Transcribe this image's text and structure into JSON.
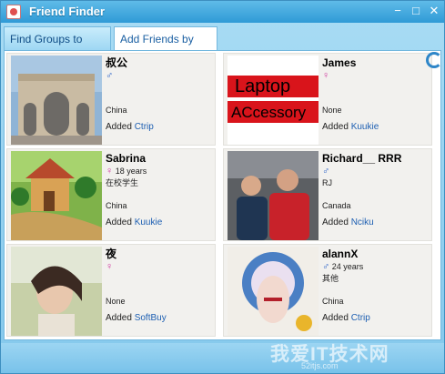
{
  "window": {
    "title": "Friend Finder"
  },
  "tabs": [
    {
      "label": "Find Groups to Join"
    },
    {
      "label": "Add Friends by App"
    }
  ],
  "added_prefix": "Added",
  "friends": [
    {
      "name": "叔公",
      "gender": "♂",
      "age": "",
      "status": "",
      "location": "China",
      "app": "Ctrip"
    },
    {
      "name": "James",
      "gender": "♀",
      "age": "",
      "status": "",
      "location": "None",
      "app": "Kuukie"
    },
    {
      "name": "Sabrina",
      "gender": "♀",
      "age": "18 years",
      "status": "在校学生",
      "location": "China",
      "app": "Kuukie"
    },
    {
      "name": "Richard__ RRR",
      "gender": "♂",
      "age": "",
      "status": "RJ",
      "location": "Canada",
      "app": "Nciku"
    },
    {
      "name": "夜",
      "gender": "♀",
      "age": "",
      "status": "",
      "location": "None",
      "app": "SoftBuy"
    },
    {
      "name": "alannX",
      "gender": "♂",
      "age": "24 years",
      "status": "其他",
      "location": "China",
      "app": "Ctrip"
    }
  ],
  "avatar_labels": {
    "laptop_line1": "Laptop",
    "laptop_line2": "ACcessory"
  },
  "watermark": {
    "text": "我爱IT技术网",
    "sub": "52itjs.com"
  }
}
